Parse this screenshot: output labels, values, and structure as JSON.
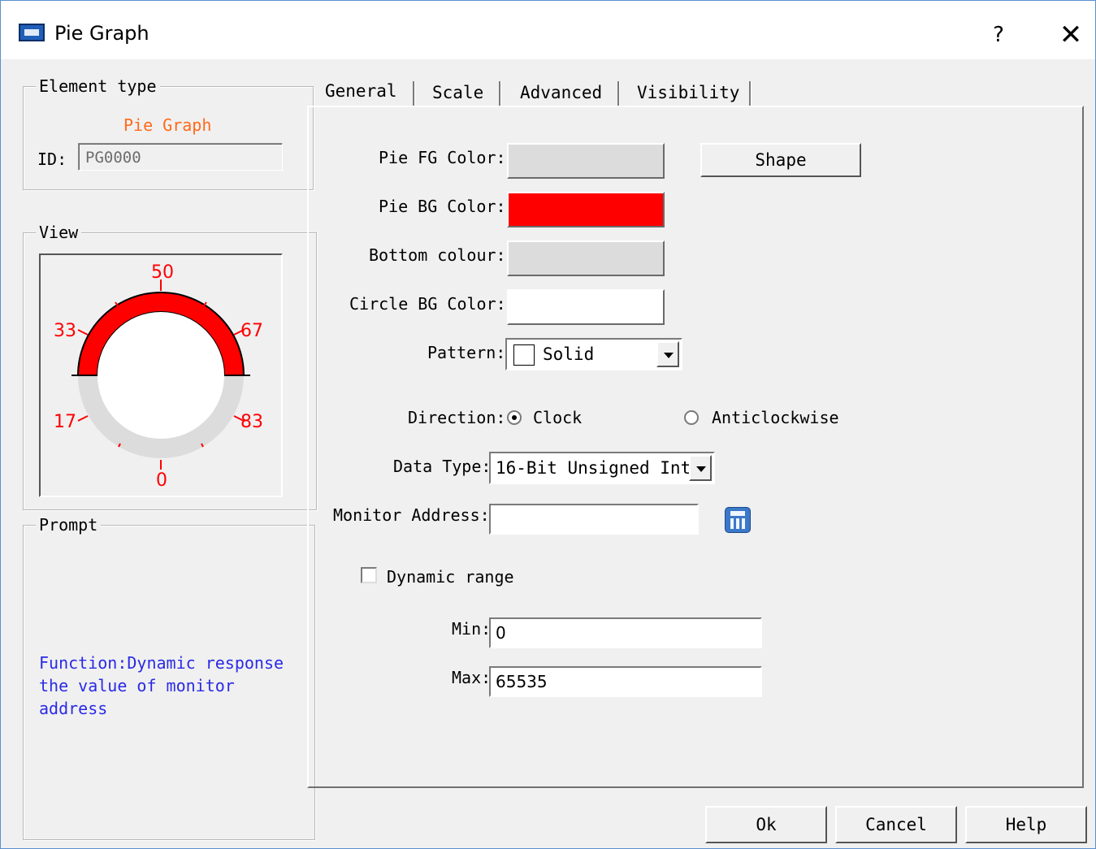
{
  "window": {
    "title": "Pie Graph",
    "help_glyph": "?",
    "close_glyph": "✕",
    "icon": "hmi-app-icon"
  },
  "element_type": {
    "legend": "Element type",
    "name": "Pie Graph",
    "id_label": "ID:",
    "id_value": "PG0000"
  },
  "view": {
    "legend": "View",
    "gauge": {
      "ticks": [
        "0",
        "17",
        "33",
        "50",
        "67",
        "83"
      ],
      "fill_color": "#ff0000",
      "track_color": "#dcdcdc",
      "label_color": "#ff0000"
    }
  },
  "prompt": {
    "legend": "Prompt",
    "text": "Function:Dynamic response the value of monitor address"
  },
  "tabs": [
    "General",
    "Scale",
    "Advanced",
    "Visibility"
  ],
  "general": {
    "pie_fg_label": "Pie FG Color:",
    "pie_fg_color": "#dcdcdc",
    "shape_button": "Shape",
    "pie_bg_label": "Pie BG Color:",
    "pie_bg_color": "#ff0000",
    "bottom_label": "Bottom colour:",
    "bottom_color": "#dcdcdc",
    "circle_bg_label": "Circle BG Color:",
    "circle_bg_color": "#ffffff",
    "pattern_label": "Pattern:",
    "pattern_value": "Solid",
    "direction_label": "Direction:",
    "direction_clock": "Clock",
    "direction_anticlockwise": "Anticlockwise",
    "direction_selected": "Clock",
    "data_type_label": "Data Type:",
    "data_type_value": "16-Bit Unsigned Int",
    "monitor_address_label": "Monitor Address:",
    "monitor_address_value": "",
    "dynamic_range_label": "Dynamic range",
    "dynamic_range_checked": false,
    "min_label": "Min:",
    "min_value": "0",
    "max_label": "Max:",
    "max_value": "65535"
  },
  "footer": {
    "ok": "Ok",
    "cancel": "Cancel",
    "help": "Help"
  }
}
